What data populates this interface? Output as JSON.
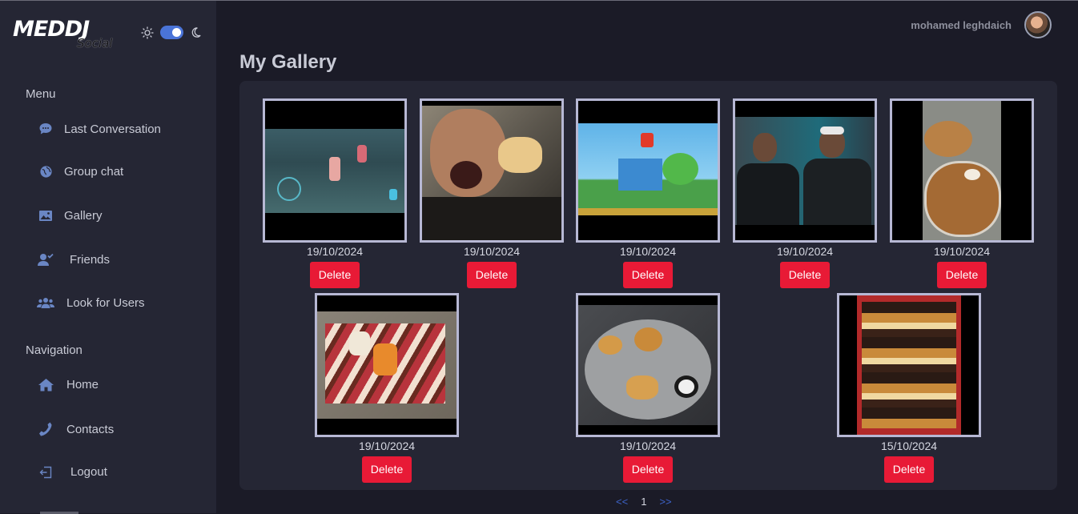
{
  "app": {
    "logo_text": "MEDDJ",
    "logo_sub": "Social"
  },
  "theme": {
    "sun_icon": "sun-icon",
    "moon_icon": "moon-icon",
    "dark_mode": true
  },
  "user": {
    "name": "mohamed leghdaich"
  },
  "sidebar": {
    "menu_title": "Menu",
    "menu": [
      {
        "label": "Last Conversation",
        "icon": "chat-bubble-icon"
      },
      {
        "label": "Group chat",
        "icon": "globe-icon"
      },
      {
        "label": "Gallery",
        "icon": "image-icon"
      },
      {
        "label": "Friends",
        "icon": "user-check-icon"
      },
      {
        "label": "Look for Users",
        "icon": "users-icon"
      }
    ],
    "nav_title": "Navigation",
    "nav": [
      {
        "label": "Home",
        "icon": "home-icon"
      },
      {
        "label": "Contacts",
        "icon": "phone-icon"
      },
      {
        "label": "Logout",
        "icon": "logout-icon"
      }
    ]
  },
  "page": {
    "title": "My Gallery"
  },
  "gallery": [
    {
      "date": "19/10/2024",
      "delete": "Delete",
      "image": "game screenshot"
    },
    {
      "date": "19/10/2024",
      "delete": "Delete",
      "image": "man eating pastry"
    },
    {
      "date": "19/10/2024",
      "delete": "Delete",
      "image": "platform game screenshot"
    },
    {
      "date": "19/10/2024",
      "delete": "Delete",
      "image": "two men photo"
    },
    {
      "date": "19/10/2024",
      "delete": "Delete",
      "image": "baked pie"
    },
    {
      "date": "19/10/2024",
      "delete": "Delete",
      "image": "desserts on tray"
    },
    {
      "date": "19/10/2024",
      "delete": "Delete",
      "image": "cookies on plate"
    },
    {
      "date": "15/10/2024",
      "delete": "Delete",
      "image": "pastry tray"
    }
  ],
  "pagination": {
    "prev": "<<",
    "current": "1",
    "next": ">>"
  }
}
